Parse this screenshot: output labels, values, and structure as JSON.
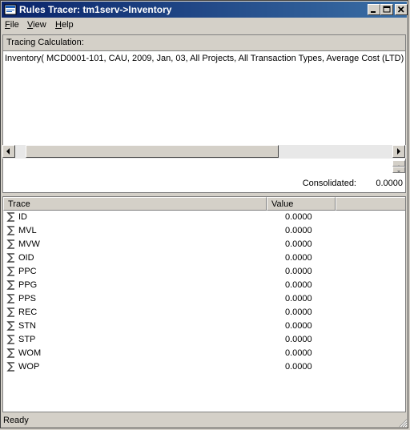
{
  "window": {
    "title": "Rules Tracer: tm1serv->Inventory"
  },
  "menu": {
    "file": {
      "mnemonic": "F",
      "rest": "ile"
    },
    "view": {
      "mnemonic": "V",
      "rest": "iew"
    },
    "help": {
      "mnemonic": "H",
      "rest": "elp"
    }
  },
  "tracing": {
    "label": "Tracing Calculation:",
    "expression": "Inventory( MCD0001-101, CAU, 2009, Jan, 03, All Projects, All Transaction Types, Average Cost (LTD),"
  },
  "consolidated": {
    "label": "Consolidated:",
    "value": "0.0000"
  },
  "table": {
    "columns": [
      "Trace",
      "Value"
    ],
    "rows": [
      {
        "name": "ID",
        "value": "0.0000"
      },
      {
        "name": "MVL",
        "value": "0.0000"
      },
      {
        "name": "MVW",
        "value": "0.0000"
      },
      {
        "name": "OID",
        "value": "0.0000"
      },
      {
        "name": "PPC",
        "value": "0.0000"
      },
      {
        "name": "PPG",
        "value": "0.0000"
      },
      {
        "name": "PPS",
        "value": "0.0000"
      },
      {
        "name": "REC",
        "value": "0.0000"
      },
      {
        "name": "STN",
        "value": "0.0000"
      },
      {
        "name": "STP",
        "value": "0.0000"
      },
      {
        "name": "WOM",
        "value": "0.0000"
      },
      {
        "name": "WOP",
        "value": "0.0000"
      }
    ]
  },
  "status": {
    "text": "Ready"
  },
  "icons": {
    "app": "app-window-icon",
    "row": "sigma-icon"
  }
}
